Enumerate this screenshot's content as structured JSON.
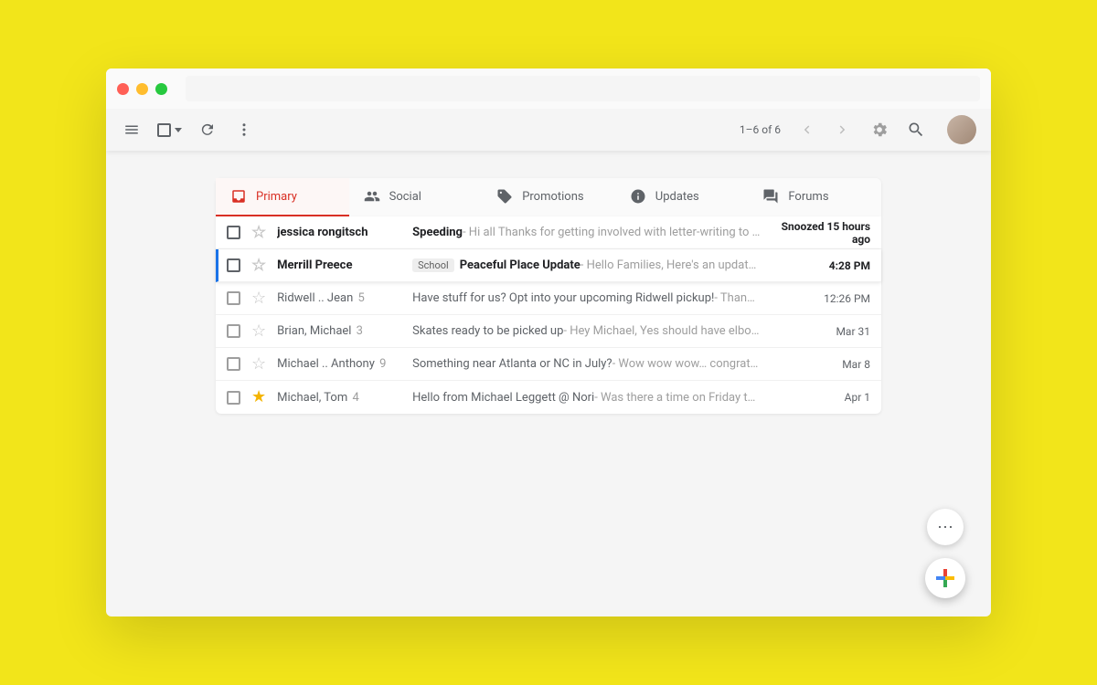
{
  "toolbar": {
    "pagination": "1–6 of 6"
  },
  "tabs": [
    {
      "label": "Primary",
      "active": true,
      "icon": "inbox"
    },
    {
      "label": "Social",
      "active": false,
      "icon": "people"
    },
    {
      "label": "Promotions",
      "active": false,
      "icon": "tag"
    },
    {
      "label": "Updates",
      "active": false,
      "icon": "info"
    },
    {
      "label": "Forums",
      "active": false,
      "icon": "forum"
    }
  ],
  "emails": [
    {
      "sender": "jessica rongitsch",
      "count": "",
      "label": "",
      "subject": "Speeding",
      "snippet": " - Hi all Thanks for getting involved with letter-writing to see if it hel…",
      "date": "Snoozed 15 hours ago",
      "unread": true,
      "highlight": false,
      "starred": false,
      "snoozed": true
    },
    {
      "sender": "Merrill Preece",
      "count": "",
      "label": "School",
      "subject": "Peaceful Place Update",
      "snippet": " - Hello Families, Here's an update on all we've been up to…",
      "date": "4:28 PM",
      "unread": true,
      "highlight": true,
      "starred": false,
      "snoozed": false
    },
    {
      "sender": "Ridwell .. Jean",
      "count": " 5",
      "label": "",
      "subject": "Have stuff for us? Opt into your upcoming Ridwell pickup!",
      "snippet": " - Thanks, Michael, I had forgot…",
      "date": "12:26 PM",
      "unread": false,
      "highlight": false,
      "starred": false,
      "snoozed": false
    },
    {
      "sender": "Brian, Michael",
      "count": " 3",
      "label": "",
      "subject": "Skates ready to be picked up",
      "snippet": " - Hey Michael, Yes should have elbow pads and knee pads, …",
      "date": "Mar 31",
      "unread": false,
      "highlight": false,
      "starred": false,
      "snoozed": false
    },
    {
      "sender": "Michael .. Anthony",
      "count": " 9",
      "label": "",
      "subject": "Something near Atlanta or NC in July?",
      "snippet": " - Wow wow wow… congrats! Sounds like you're pl…",
      "date": "Mar 8",
      "unread": false,
      "highlight": false,
      "starred": false,
      "snoozed": false
    },
    {
      "sender": "Michael, Tom",
      "count": " 4",
      "label": "",
      "subject": "Hello from Michael Leggett @ Nori",
      "snippet": " - Was there a time on Friday that works for you?",
      "date": "Apr 1",
      "unread": false,
      "highlight": false,
      "starred": true,
      "snoozed": false
    }
  ]
}
